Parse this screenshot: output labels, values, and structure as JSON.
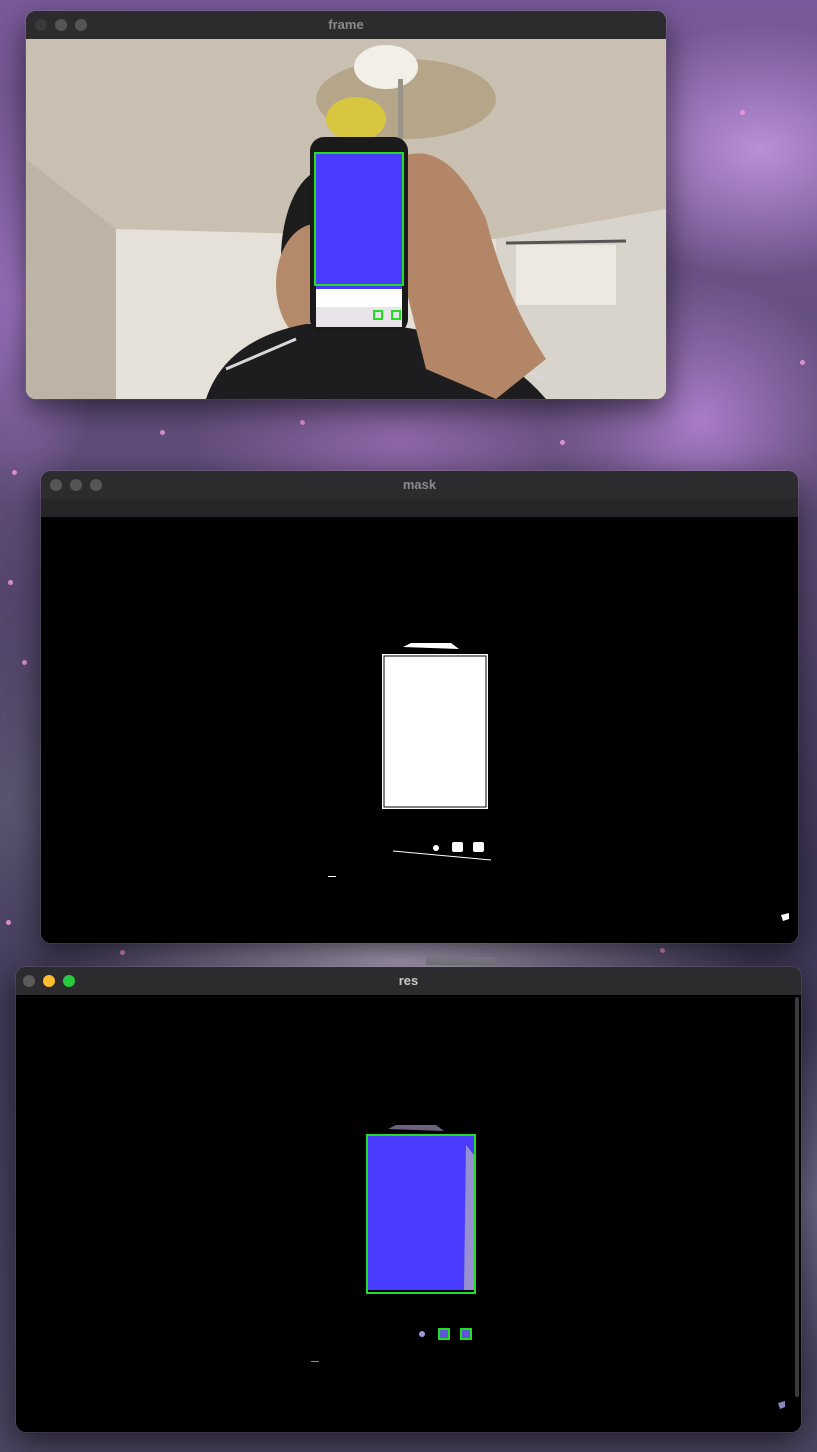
{
  "windows": {
    "frame": {
      "title": "frame"
    },
    "mask": {
      "title": "mask"
    },
    "res": {
      "title": "res"
    }
  },
  "colors": {
    "titlebar": "#2c2c2e",
    "window_bg": "#000000",
    "detection_box": "#22dd22",
    "phone_screen": "#4a3cff",
    "mask_white": "#ffffff",
    "traffic_yellow": "#febc2e",
    "traffic_green": "#28c840"
  }
}
